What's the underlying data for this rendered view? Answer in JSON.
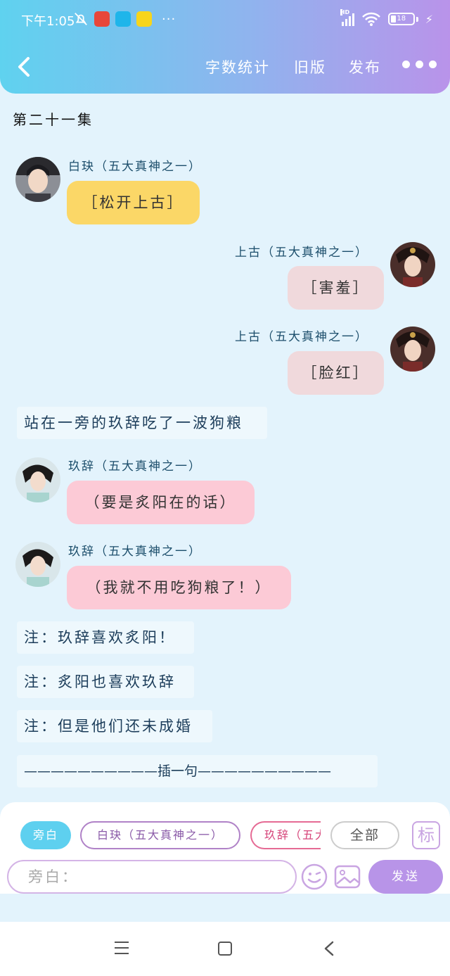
{
  "status_bar": {
    "time": "下午1:05",
    "more": "···",
    "hd": "HD",
    "battery": "18"
  },
  "header": {
    "nav": {
      "word_count": "字数统计",
      "old_version": "旧版",
      "publish": "发布"
    }
  },
  "episode_title": "第二十一集",
  "messages": [
    {
      "speaker": "白玦（五大真神之一）",
      "text": "［松开上古］",
      "side": "left",
      "color": "#fbd767"
    },
    {
      "speaker": "上古（五大真神之一）",
      "text": "［害羞］",
      "side": "right",
      "color": "#f0d9dc"
    },
    {
      "speaker": "上古（五大真神之一）",
      "text": "［脸红］",
      "side": "right",
      "color": "#f0d9dc"
    },
    {
      "narration": "站在一旁的玖辞吃了一波狗粮"
    },
    {
      "speaker": "玖辞（五大真神之一）",
      "text": "（要是炙阳在的话）",
      "side": "left",
      "color": "#fccad6"
    },
    {
      "speaker": "玖辞（五大真神之一）",
      "text": "（我就不用吃狗粮了！）",
      "side": "left",
      "color": "#fccad6"
    },
    {
      "narration": "注：玖辞喜欢炙阳！"
    },
    {
      "narration": "注：炙阳也喜欢玖辞"
    },
    {
      "narration": "注：但是他们还未成婚"
    },
    {
      "narration": "——————————插一句——————————"
    }
  ],
  "composer": {
    "chips": [
      "旁白",
      "白玦（五大真神之一）",
      "玖辞（五大真神之一）",
      "全部"
    ],
    "tag_label": "标",
    "input_value": "旁白：",
    "send_label": "发送"
  }
}
